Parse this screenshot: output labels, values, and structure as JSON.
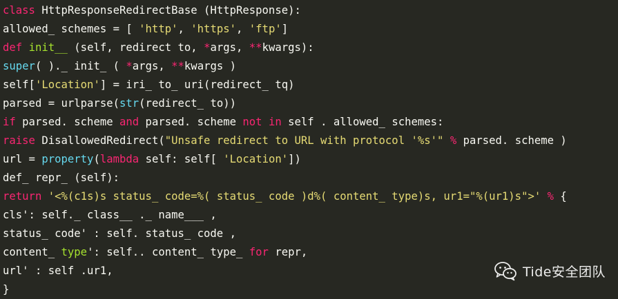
{
  "code_lines": [
    [
      {
        "t": "class",
        "k": "keyword"
      },
      {
        "t": " HttpResponseRedirectBase (HttpResponse):",
        "k": "text"
      }
    ],
    [
      {
        "t": "allowed_ schemes = [ ",
        "k": "text"
      },
      {
        "t": "'http'",
        "k": "string"
      },
      {
        "t": ", ",
        "k": "text"
      },
      {
        "t": "'https'",
        "k": "string"
      },
      {
        "t": ", ",
        "k": "text"
      },
      {
        "t": "'ftp'",
        "k": "string"
      },
      {
        "t": "]",
        "k": "text"
      }
    ],
    [
      {
        "t": "def",
        "k": "keyword"
      },
      {
        "t": " ",
        "k": "text"
      },
      {
        "t": "init__",
        "k": "function"
      },
      {
        "t": " (self, redirect to, ",
        "k": "text"
      },
      {
        "t": "*",
        "k": "operator"
      },
      {
        "t": "args, ",
        "k": "text"
      },
      {
        "t": "**",
        "k": "operator"
      },
      {
        "t": "kwargs):",
        "k": "text"
      }
    ],
    [
      {
        "t": "super",
        "k": "builtin"
      },
      {
        "t": "( ).",
        "k": "text"
      },
      {
        "t": "_ init_ ( ",
        "k": "text"
      },
      {
        "t": "*",
        "k": "operator"
      },
      {
        "t": "args, ",
        "k": "text"
      },
      {
        "t": "**",
        "k": "operator"
      },
      {
        "t": "kwargs )",
        "k": "text"
      }
    ],
    [
      {
        "t": "self[",
        "k": "text"
      },
      {
        "t": "'Location'",
        "k": "string"
      },
      {
        "t": "] = iri_ to_ uri(redirect_ tq)",
        "k": "text"
      }
    ],
    [
      {
        "t": "parsed = urlparse(",
        "k": "text"
      },
      {
        "t": "str",
        "k": "builtin"
      },
      {
        "t": "(redirect_ to))",
        "k": "text"
      }
    ],
    [
      {
        "t": "if",
        "k": "keyword"
      },
      {
        "t": " parsed. scheme ",
        "k": "text"
      },
      {
        "t": "and",
        "k": "keyword"
      },
      {
        "t": " parsed. scheme ",
        "k": "text"
      },
      {
        "t": "not",
        "k": "keyword"
      },
      {
        "t": " ",
        "k": "text"
      },
      {
        "t": "in",
        "k": "keyword"
      },
      {
        "t": " self . allowed_ schemes:",
        "k": "text"
      }
    ],
    [
      {
        "t": "raise",
        "k": "keyword"
      },
      {
        "t": " DisallowedRedirect(",
        "k": "text"
      },
      {
        "t": "\"Unsafe redirect to URL with protocol '%s'\"",
        "k": "string"
      },
      {
        "t": " ",
        "k": "text"
      },
      {
        "t": "%",
        "k": "operator"
      },
      {
        "t": " parsed. scheme )",
        "k": "text"
      }
    ],
    [
      {
        "t": "url = ",
        "k": "text"
      },
      {
        "t": "property",
        "k": "builtin"
      },
      {
        "t": "(",
        "k": "text"
      },
      {
        "t": "lambda",
        "k": "keyword"
      },
      {
        "t": " self: self[ ",
        "k": "text"
      },
      {
        "t": "'Location'",
        "k": "string"
      },
      {
        "t": "])",
        "k": "text"
      }
    ],
    [
      {
        "t": "def_ repr_ (self):",
        "k": "text"
      }
    ],
    [
      {
        "t": "return",
        "k": "keyword"
      },
      {
        "t": " ",
        "k": "text"
      },
      {
        "t": "'<%(c1s)s status_ code=%( status_ code )d%( content_ type)s, ur1=\"%(ur1)s\">'",
        "k": "string"
      },
      {
        "t": " ",
        "k": "text"
      },
      {
        "t": "%",
        "k": "operator"
      },
      {
        "t": " {",
        "k": "text"
      }
    ],
    [
      {
        "t": "cls': self._ class__ ._ name___ ,",
        "k": "text"
      }
    ],
    [
      {
        "t": "status_ code' : self. status_ code ,",
        "k": "text"
      }
    ],
    [
      {
        "t": "content_ ",
        "k": "text"
      },
      {
        "t": "type",
        "k": "function"
      },
      {
        "t": "': self.. content_ type_ ",
        "k": "text"
      },
      {
        "t": "for",
        "k": "keyword"
      },
      {
        "t": " repr,",
        "k": "text"
      }
    ],
    [
      {
        "t": "url' : self .ur1,",
        "k": "text"
      }
    ],
    [
      {
        "t": "}",
        "k": "text"
      }
    ]
  ],
  "watermark": {
    "icon": "wechat-icon",
    "label": "Tide安全团队"
  },
  "colors": {
    "background": "#272822",
    "text": "#f8f8f2",
    "keyword": "#f92672",
    "function": "#a6e22e",
    "builtin": "#66d9ef",
    "string": "#e6db74"
  }
}
